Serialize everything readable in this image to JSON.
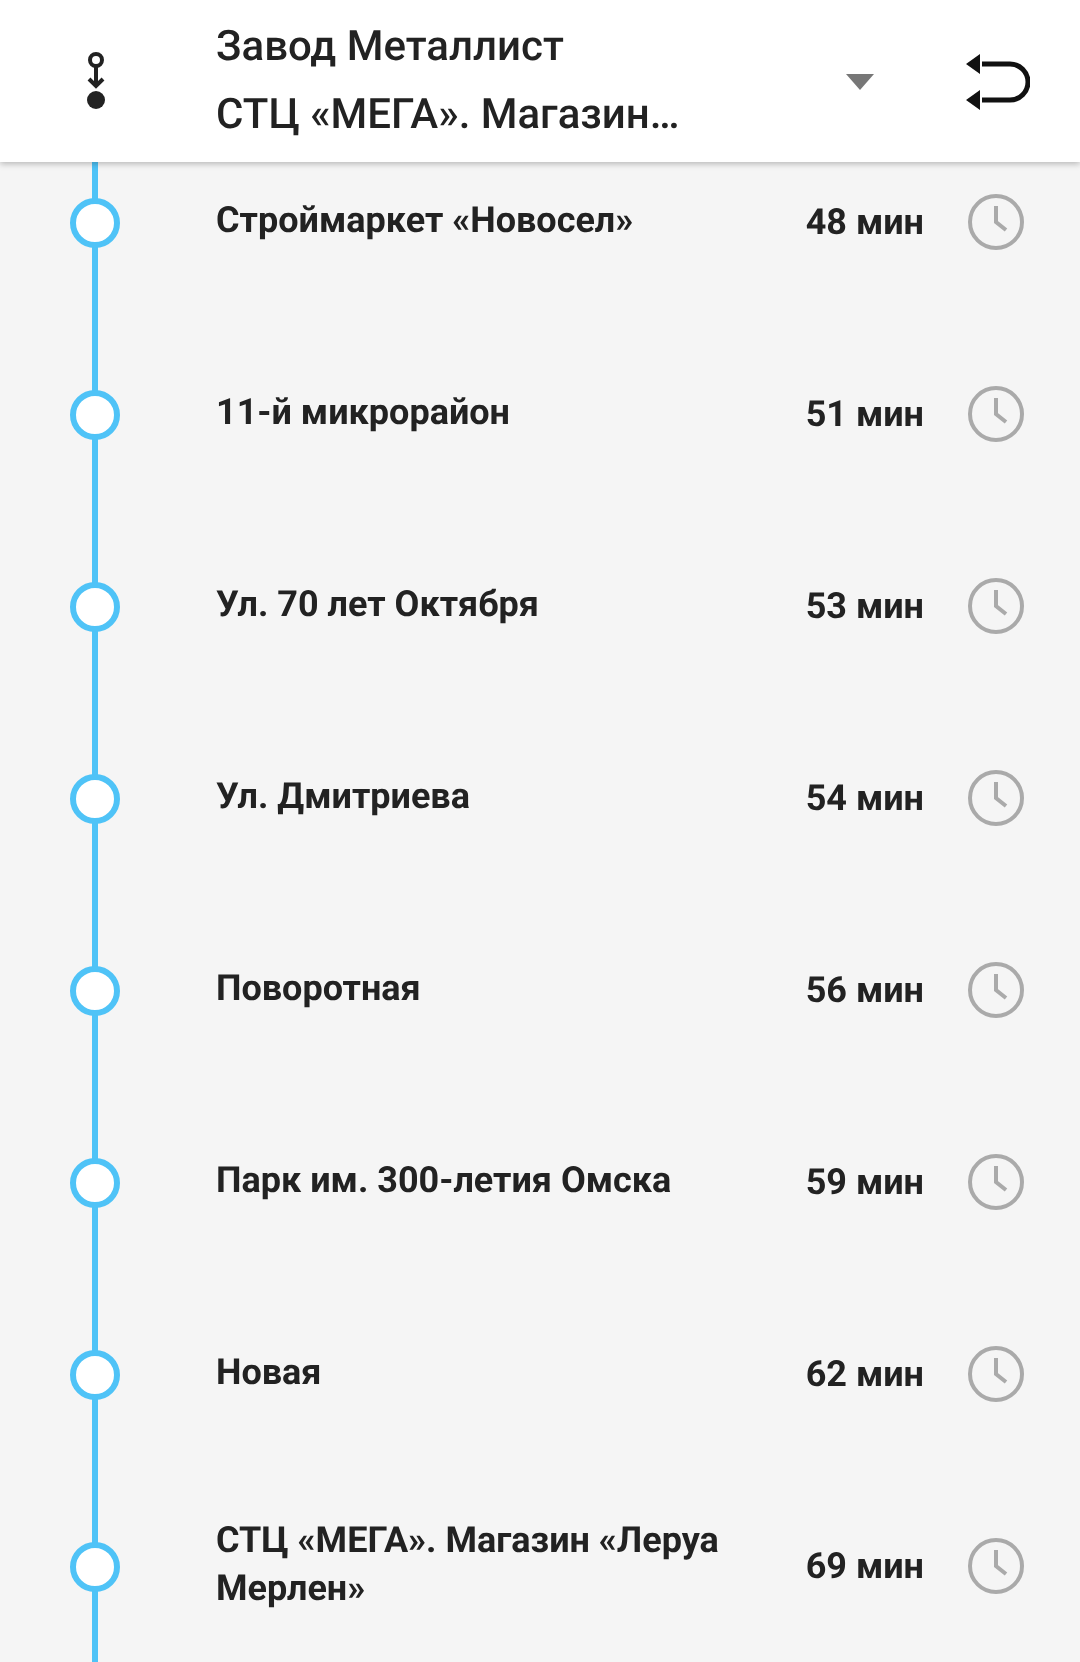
{
  "header": {
    "from": "Завод Металлист",
    "to": "СТЦ «МЕГА». Магазин…"
  },
  "stops": [
    {
      "name": "Строймаркет «Новосел»",
      "time": "48 мин"
    },
    {
      "name": "11-й микрорайон",
      "time": "51 мин"
    },
    {
      "name": "Ул. 70 лет Октября",
      "time": "53 мин"
    },
    {
      "name": "Ул. Дмитриева",
      "time": "54 мин"
    },
    {
      "name": "Поворотная",
      "time": "56 мин"
    },
    {
      "name": "Парк им. 300-летия Омска",
      "time": "59 мин"
    },
    {
      "name": "Новая",
      "time": "62 мин"
    },
    {
      "name": "СТЦ «МЕГА». Магазин «Леруа Мерлен»",
      "time": "69 мин"
    }
  ]
}
